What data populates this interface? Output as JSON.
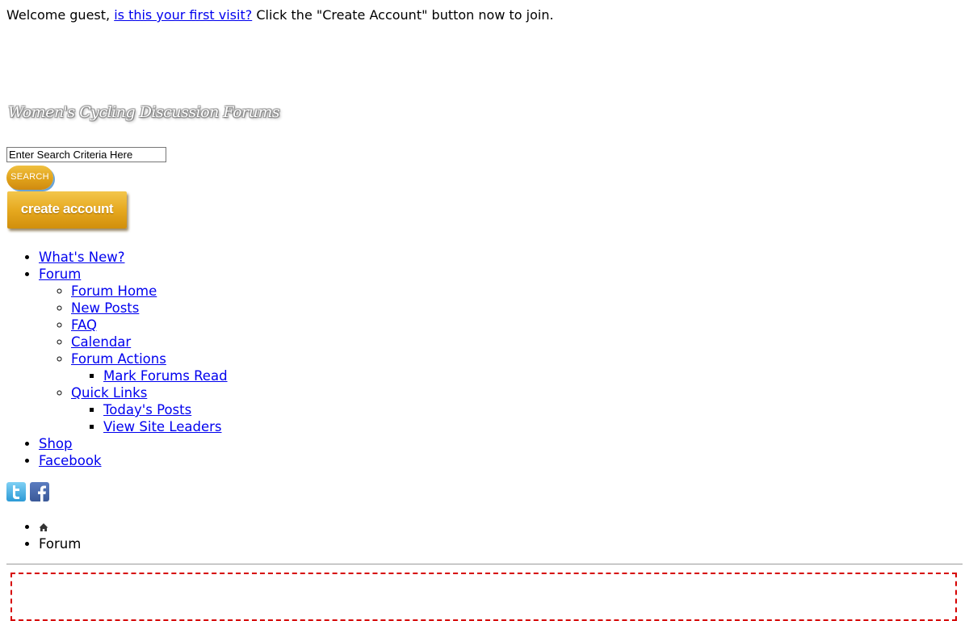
{
  "welcome": {
    "prefix": "Welcome guest, ",
    "link": "is this your first visit?",
    "suffix": " Click the \"Create Account\" button now to join."
  },
  "logo_text": "Women's Cycling Discussion Forums",
  "search": {
    "input_value": "Enter Search Criteria Here",
    "button_label": "SEARCH"
  },
  "create_account_label": "create account",
  "nav": {
    "whats_new": "What's New?",
    "forum": "Forum",
    "forum_home": "Forum Home",
    "new_posts": "New Posts",
    "faq": "FAQ",
    "calendar": "Calendar",
    "forum_actions": "Forum Actions",
    "mark_forums_read": "Mark Forums Read",
    "quick_links": "Quick Links",
    "todays_posts": "Today's Posts",
    "view_site_leaders": "View Site Leaders",
    "shop": "Shop",
    "facebook": "Facebook"
  },
  "breadcrumb": {
    "home_icon": "home-icon",
    "current": "Forum"
  },
  "social_icons": [
    "twitter-icon",
    "facebook-icon"
  ],
  "colors": {
    "link": "#0000ee",
    "button_gold": "#e6a91f",
    "notice_border": "#d60000"
  }
}
